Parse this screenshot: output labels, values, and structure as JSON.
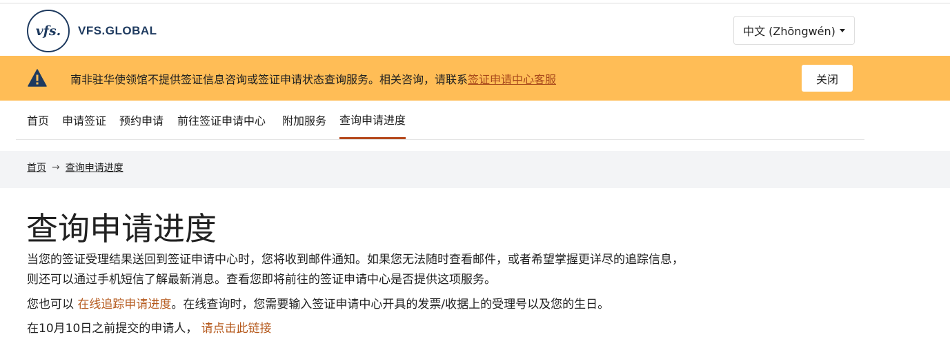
{
  "header": {
    "logo_mark": "vfs.",
    "logo_text": "VFS.GLOBAL",
    "language": "中文 (Zhōngwén)"
  },
  "alert": {
    "message": "南非驻华使领馆不提供签证信息咨询或签证申请状态查询服务。相关咨询，请联系",
    "link": "签证申请中心客服",
    "close_label": "关闭",
    "icon": "warning-icon"
  },
  "nav": {
    "items": [
      {
        "label": "首页"
      },
      {
        "label": "申请签证"
      },
      {
        "label": "预约申请"
      },
      {
        "label": "前往签证申请中心"
      },
      {
        "label": "附加服务"
      },
      {
        "label": "查询申请进度"
      }
    ],
    "active_index": 5
  },
  "breadcrumb": {
    "home": "首页",
    "current": "查询申请进度"
  },
  "main": {
    "title": "查询申请进度",
    "paragraph1": "当您的签证受理结果送回到签证申请中心时，您将收到邮件通知。如果您无法随时查看邮件，或者希望掌握更详尽的追踪信息，则还可以通过手机短信了解最新消息。查看您即将前往的签证申请中心是否提供这项服务。",
    "paragraph2_prefix": "您也可以 ",
    "paragraph2_link": "在线追踪申请进度",
    "paragraph2_suffix": "。在线查询时，您需要输入签证申请中心开具的发票/收据上的受理号以及您的生日。",
    "paragraph3_prefix": "在10月10日之前提交的申请人， ",
    "paragraph3_link": "请点击此链接"
  },
  "colors": {
    "alert_bg": "#ffbd56",
    "accent": "#b5481c",
    "brand": "#1e3a5f"
  }
}
